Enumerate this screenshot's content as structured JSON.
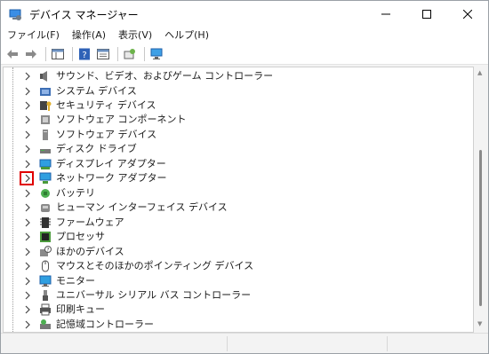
{
  "window": {
    "title": "デバイス マネージャー"
  },
  "menu": [
    "ファイル(F)",
    "操作(A)",
    "表示(V)",
    "ヘルプ(H)"
  ],
  "tree": {
    "items": [
      {
        "label": "サウンド、ビデオ、およびゲーム コントローラー",
        "icon": "speaker-icon"
      },
      {
        "label": "システム デバイス",
        "icon": "system-folder-icon"
      },
      {
        "label": "セキュリティ デバイス",
        "icon": "security-key-icon"
      },
      {
        "label": "ソフトウェア コンポーネント",
        "icon": "puzzle-icon"
      },
      {
        "label": "ソフトウェア デバイス",
        "icon": "device-icon"
      },
      {
        "label": "ディスク ドライブ",
        "icon": "disk-drive-icon"
      },
      {
        "label": "ディスプレイ アダプター",
        "icon": "display-adapter-icon"
      },
      {
        "label": "ネットワーク アダプター",
        "icon": "network-adapter-icon",
        "highlighted": true
      },
      {
        "label": "バッテリ",
        "icon": "battery-icon"
      },
      {
        "label": "ヒューマン インターフェイス デバイス",
        "icon": "hid-icon"
      },
      {
        "label": "ファームウェア",
        "icon": "firmware-icon"
      },
      {
        "label": "プロセッサ",
        "icon": "processor-icon"
      },
      {
        "label": "ほかのデバイス",
        "icon": "unknown-device-icon"
      },
      {
        "label": "マウスとそのほかのポインティング デバイス",
        "icon": "mouse-icon"
      },
      {
        "label": "モニター",
        "icon": "monitor-icon"
      },
      {
        "label": "ユニバーサル シリアル バス コントローラー",
        "icon": "usb-icon"
      },
      {
        "label": "印刷キュー",
        "icon": "printer-icon"
      },
      {
        "label": "記憶域コントローラー",
        "icon": "storage-controller-icon"
      }
    ]
  },
  "colors": {
    "highlight_box": "#e00000",
    "accent": "#0067c0"
  }
}
